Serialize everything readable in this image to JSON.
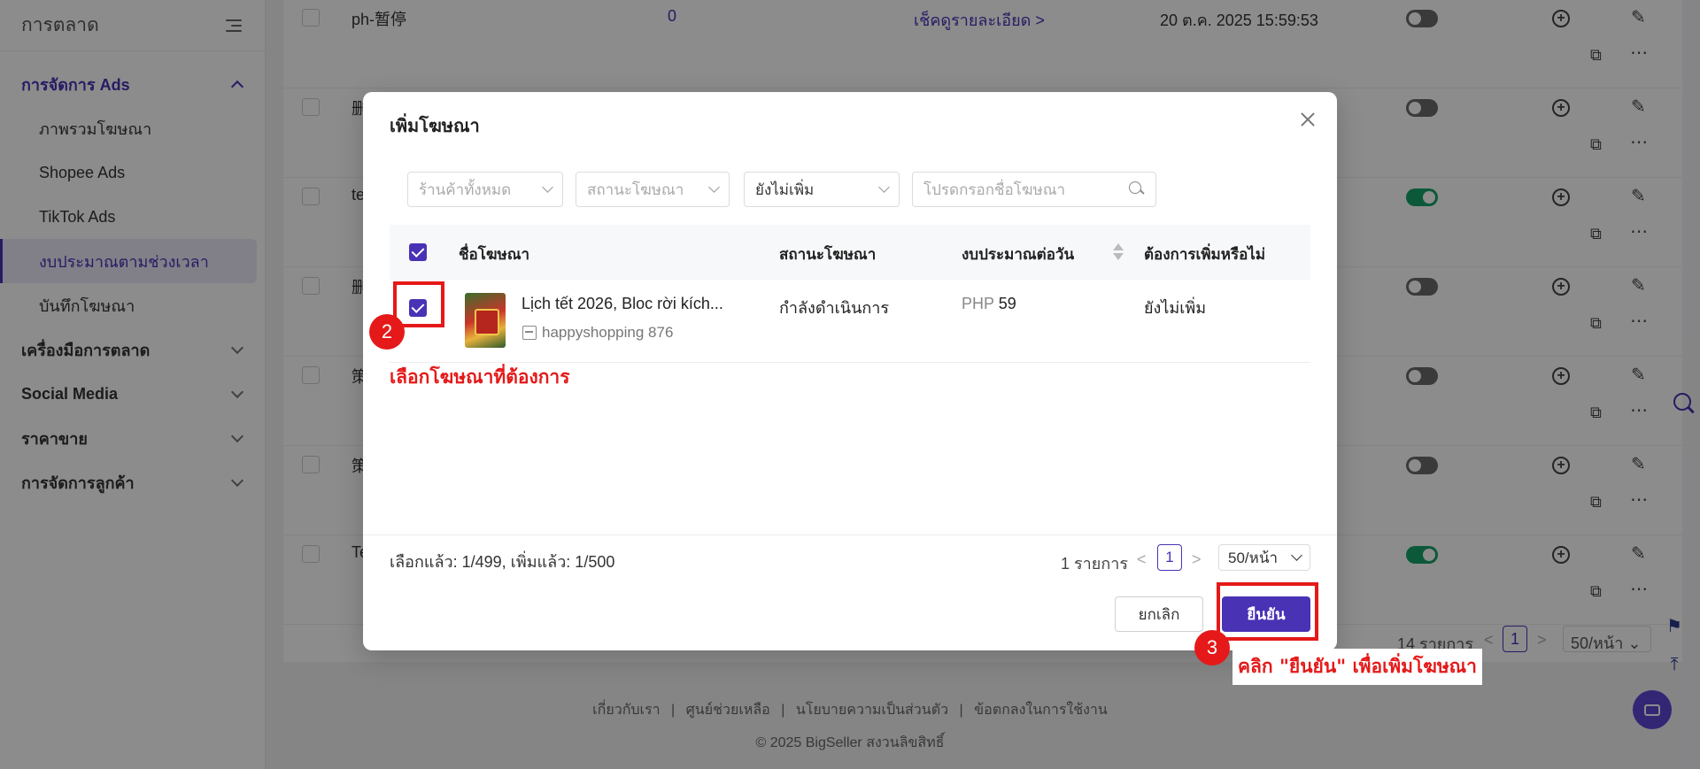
{
  "sidebar": {
    "title": "การตลาด",
    "sections": [
      {
        "label": "การจัดการ Ads",
        "expanded": true,
        "items": [
          {
            "label": "ภาพรวมโฆษณา"
          },
          {
            "label": "Shopee Ads"
          },
          {
            "label": "TikTok Ads"
          },
          {
            "label": "งบประมาณตามช่วงเวลา",
            "selected": true
          },
          {
            "label": "บันทึกโฆษณา"
          }
        ]
      },
      {
        "label": "เครื่องมือการตลาด"
      },
      {
        "label": "Social Media"
      },
      {
        "label": "ราคาขาย"
      },
      {
        "label": "การจัดการลูกค้า"
      }
    ]
  },
  "background_table": {
    "rows": [
      {
        "name": "ph-暂停",
        "count": "0",
        "link": "เช็คดูรายละเอียด",
        "date": "20 ต.ค. 2025 15:59:53",
        "toggle": "off"
      },
      {
        "name": "删",
        "toggle": "off"
      },
      {
        "name": "te",
        "toggle": "on"
      },
      {
        "name": "删",
        "toggle": "off"
      },
      {
        "name": "策",
        "toggle": "off"
      },
      {
        "name": "策",
        "toggle": "off"
      },
      {
        "name": "Te",
        "toggle": "on"
      }
    ],
    "pagination": {
      "total": "14 รายการ",
      "page": "1",
      "per_page": "50/หน้า"
    }
  },
  "footer": {
    "links": [
      "เกี่ยวกับเรา",
      "ศูนย์ช่วยเหลือ",
      "นโยบายความเป็นส่วนตัว",
      "ข้อตกลงในการใช้งาน"
    ],
    "separator": "|",
    "copyright": "© 2025 BigSeller สงวนลิขสิทธิ์"
  },
  "modal": {
    "title": "เพิ่มโฆษณา",
    "filters": {
      "store_placeholder": "ร้านค้าทั้งหมด",
      "status_placeholder": "สถานะโฆษณา",
      "added_value": "ยังไม่เพิ่ม",
      "search_placeholder": "โปรดกรอกชื่อโฆษณา"
    },
    "columns": {
      "name": "ชื่อโฆษณา",
      "status": "สถานะโฆษณา",
      "budget": "งบประมาณต่อวัน",
      "add": "ต้องการเพิ่มหรือไม่"
    },
    "rows": [
      {
        "name": "Lịch tết 2026, Bloc rời kích...",
        "shop": "happyshopping 876",
        "status": "กำลังดำเนินการ",
        "currency": "PHP",
        "budget": "59",
        "add": "ยังไม่เพิ่ม",
        "checked": true
      }
    ],
    "selected_info": "เลือกแล้ว: 1/499, เพิ่มแล้ว: 1/500",
    "pagination": {
      "total": "1 รายการ",
      "page": "1",
      "per_page": "50/หน้า"
    },
    "cancel_label": "ยกเลิก",
    "confirm_label": "ยืนยัน"
  },
  "annotations": {
    "step2_number": "2",
    "step2_text": "เลือกโฆษณาที่ต้องการ",
    "step3_number": "3",
    "step3_text": "คลิก \"ยืนยัน\" เพื่อเพิ่มโฆษณา",
    "color": "#e51919"
  },
  "colors": {
    "accent": "#4a32b5",
    "toggle_on": "#17a36b",
    "annotation": "#e51919"
  }
}
